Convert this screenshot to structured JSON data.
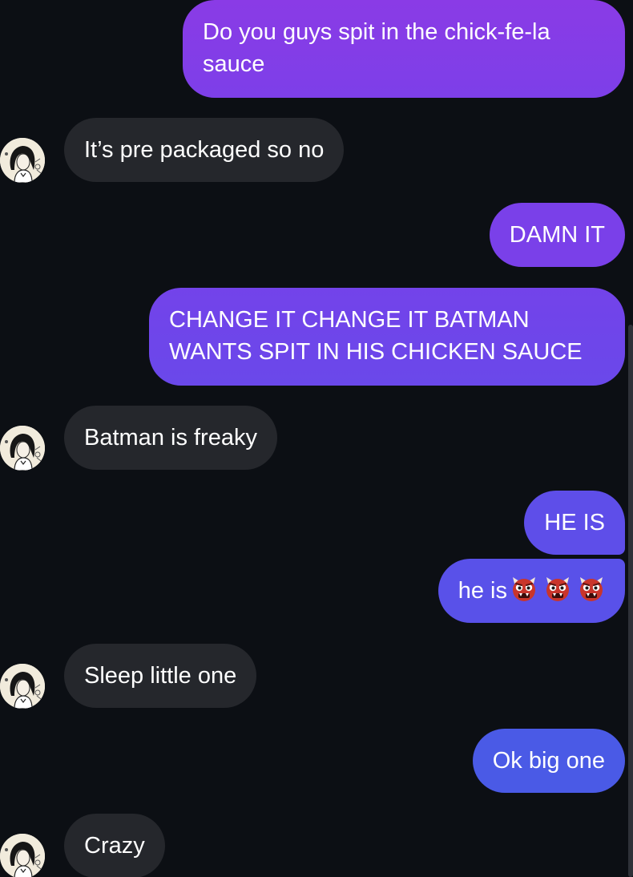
{
  "colors": {
    "background": "#0c0f14",
    "incoming_bubble": "#25272c",
    "outgoing_gradient_top": "#8a3be6",
    "outgoing_gradient_bottom": "#4a5ae6"
  },
  "messages": [
    {
      "direction": "outgoing",
      "text": "Do you guys spit in the chick-fe-la sauce"
    },
    {
      "direction": "incoming",
      "text": "It’s pre packaged so no",
      "avatar_icon": "contact-avatar-icon"
    },
    {
      "direction": "outgoing",
      "text": "DAMN IT"
    },
    {
      "direction": "outgoing",
      "text": "CHANGE IT CHANGE IT BATMAN WANTS SPIT IN HIS CHICKEN SAUCE"
    },
    {
      "direction": "incoming",
      "text": "Batman is freaky",
      "avatar_icon": "contact-avatar-icon"
    },
    {
      "direction": "outgoing",
      "text": "HE IS"
    },
    {
      "direction": "outgoing",
      "text": "he is",
      "emojis": [
        "ogre-emoji",
        "ogre-emoji",
        "ogre-emoji"
      ]
    },
    {
      "direction": "incoming",
      "text": "Sleep little one",
      "avatar_icon": "contact-avatar-icon"
    },
    {
      "direction": "outgoing",
      "text": "Ok big one"
    },
    {
      "direction": "incoming",
      "text": "Crazy",
      "avatar_icon": "contact-avatar-icon"
    }
  ]
}
